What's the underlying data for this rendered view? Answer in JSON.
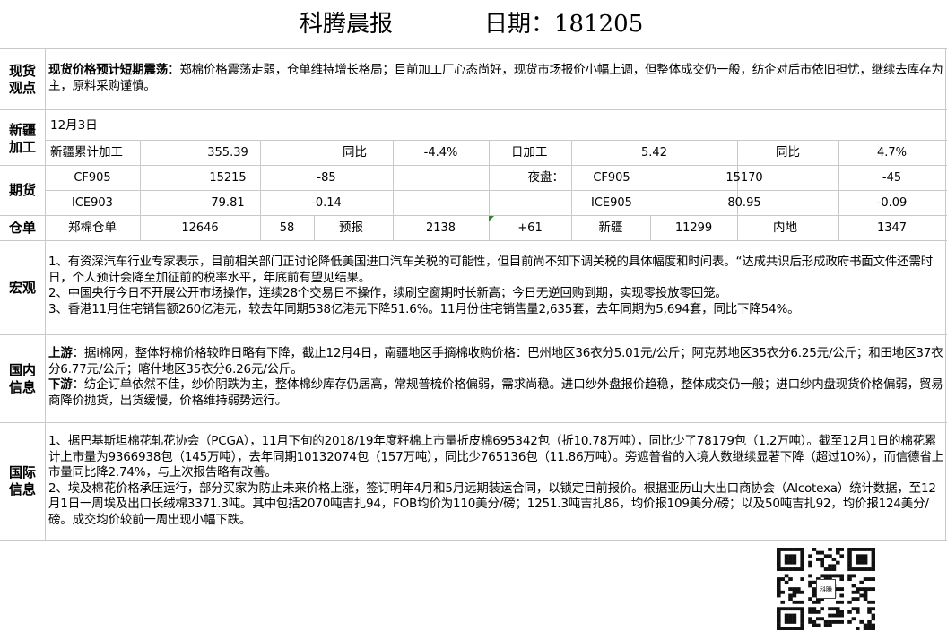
{
  "header": {
    "title": "科腾晨报",
    "date_label": "日期：181205"
  },
  "spot": {
    "section": "现货\n观点",
    "bold": "现货价格预计短期震荡",
    "text": "：郑棉价格震荡走弱，仓单维持增长格局；目前加工厂心态尚好，现货市场报价小幅上调，但整体成交仍一般，纺企对后市依旧担忧，继续去库存为主，原料采购谨慎。"
  },
  "xinjiang": {
    "section": "新疆\n加工",
    "date": "12月3日",
    "cum_label": "新疆累计加工",
    "cum_value": "355.39",
    "yoy_label": "同比",
    "yoy_value": "-4.4%",
    "daily_label": "日加工",
    "daily_value": "5.42",
    "yoy2_label": "同比",
    "yoy2_value": "4.7%"
  },
  "futures": {
    "section": "期货",
    "rows": [
      {
        "code": "CF905",
        "price": "15215",
        "chg": "-85",
        "night": "夜盘：",
        "ncode": "CF905",
        "nprice": "15170",
        "nchg": "-45"
      },
      {
        "code": "ICE903",
        "price": "79.81",
        "chg": "-0.14",
        "night": "",
        "ncode": "ICE905",
        "nprice": "80.95",
        "nchg": "-0.09"
      }
    ]
  },
  "warehouse": {
    "section": "仓单",
    "label": "郑棉仓单",
    "value": "12646",
    "chg": "58",
    "forecast_label": "预报",
    "forecast_value": "2138",
    "forecast_chg": "+61",
    "xj_label": "新疆",
    "xj_value": "11299",
    "nd_label": "内地",
    "nd_value": "1347"
  },
  "macro": {
    "section": "宏观",
    "text": "1、有资深汽车行业专家表示，目前相关部门正讨论降低美国进口汽车关税的可能性，但目前尚不知下调关税的具体幅度和时间表。“达成共识后形成政府书面文件还需时日，个人预计会降至加征前的税率水平，年底前有望见结果。\n2、中国央行今日不开展公开市场操作，连续28个交易日不操作，续刷空窗期时长新高；今日无逆回购到期，实现零投放零回笼。\n3、香港11月住宅销售额260亿港元，较去年同期538亿港元下降51.6%。11月份住宅销售量2,635套，去年同期为5,694套，同比下降54%。"
  },
  "domestic": {
    "section": "国内\n信息",
    "up_bold": "上游",
    "up_text": "：据i棉网，整体籽棉价格较昨日略有下降，截止12月4日，南疆地区手摘棉收购价格：巴州地区36衣分5.01元/公斤；阿克苏地区35衣分6.25元/公斤；和田地区37衣分6.77元/公斤；喀什地区35衣分6.26元/公斤。",
    "down_bold": "下游",
    "down_text": "：纺企订单依然不佳，纱价阴跌为主，整体棉纱库存仍居高，常规普梳价格偏弱，需求尚稳。进口纱外盘报价趋稳，整体成交仍一般；进口纱内盘现货价格偏弱，贸易商降价抛货，出货缓慢，价格维持弱势运行。"
  },
  "intl": {
    "section": "国际\n信息",
    "text": "1、据巴基斯坦棉花轧花协会（PCGA），11月下旬的2018/19年度籽棉上市量折皮棉695342包（折10.78万吨），同比少了78179包（1.2万吨）。截至12月1日的棉花累计上市量为9366938包（145万吨），去年同期10132074包（157万吨），同比少765136包（11.86万吨）。旁遮普省的入境人数继续显著下降（超过10%），而信德省上市量同比降2.74%，与上次报告略有改善。\n2、埃及棉花价格承压运行，部分买家为防止未来价格上涨，签订明年4月和5月远期装运合同，以锁定目前报价。根据亚历山大出口商协会（Alcotexa）统计数据，至12月1日一周埃及出口长绒棉3371.3吨。其中包括2070吨吉扎94，FOB均价为110美分/磅；1251.3吨吉扎86，均价报109美分/磅；以及50吨吉扎92，均价报124美分/磅。成交均价较前一周出现小幅下跌。"
  },
  "qr": {
    "center_label": "科腾"
  }
}
